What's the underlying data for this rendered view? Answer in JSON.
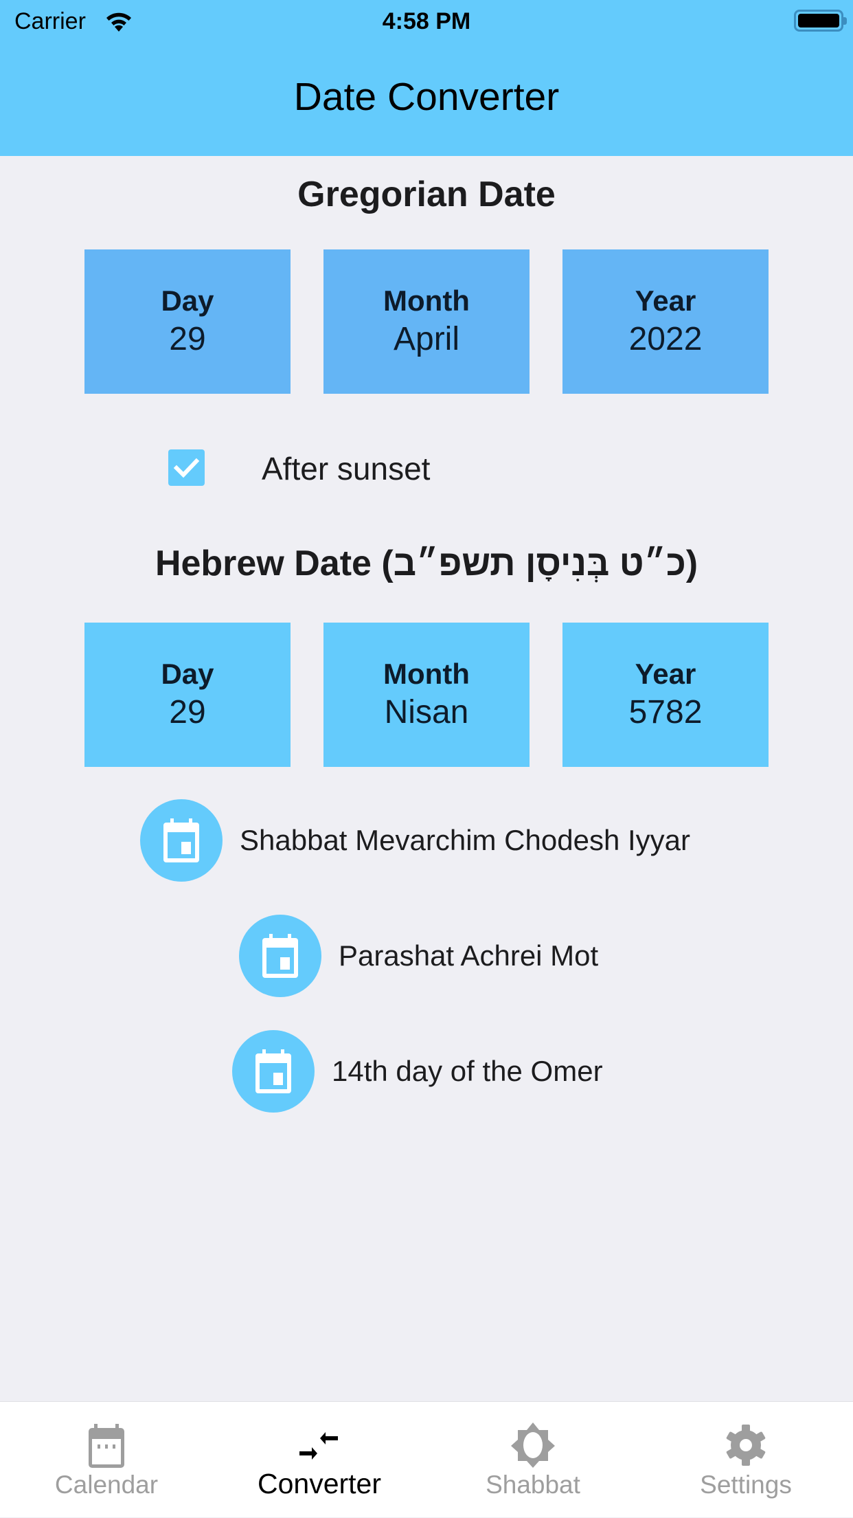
{
  "status_bar": {
    "carrier": "Carrier",
    "time": "4:58 PM"
  },
  "header": {
    "title": "Date Converter"
  },
  "gregorian": {
    "title": "Gregorian Date",
    "day": {
      "label": "Day",
      "value": "29"
    },
    "month": {
      "label": "Month",
      "value": "April"
    },
    "year": {
      "label": "Year",
      "value": "2022"
    }
  },
  "after_sunset": {
    "label": "After sunset",
    "checked": true
  },
  "hebrew": {
    "title": "Hebrew Date (כ״ט בְּנִיסָן תשפ״ב)",
    "day": {
      "label": "Day",
      "value": "29"
    },
    "month": {
      "label": "Month",
      "value": "Nisan"
    },
    "year": {
      "label": "Year",
      "value": "5782"
    }
  },
  "events": [
    {
      "icon": "calendar-icon",
      "text": "Shabbat Mevarchim Chodesh Iyyar"
    },
    {
      "icon": "calendar-icon",
      "text": "Parashat Achrei Mot"
    },
    {
      "icon": "calendar-icon",
      "text": "14th day of the Omer"
    }
  ],
  "tabs": [
    {
      "label": "Calendar",
      "icon": "calendar-icon",
      "active": false
    },
    {
      "label": "Converter",
      "icon": "converter-arrows-icon",
      "active": true
    },
    {
      "label": "Shabbat",
      "icon": "sun-icon",
      "active": false
    },
    {
      "label": "Settings",
      "icon": "gear-icon",
      "active": false
    }
  ],
  "colors": {
    "accent": "#64cbfc",
    "gregorian_box": "#64b5f5",
    "background": "#efeff4"
  }
}
